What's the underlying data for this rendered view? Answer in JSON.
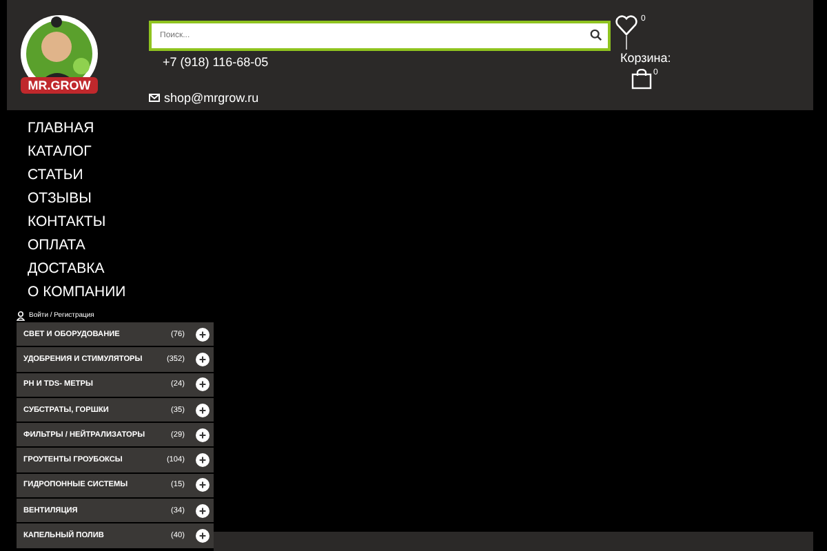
{
  "header": {
    "logo_text": "MR.GROW",
    "search": {
      "placeholder": "Поиск..."
    },
    "phone": "+7 (918) 116-68-05",
    "email": "shop@mrgrow.ru",
    "wishlist_count": "0",
    "cart_label": "Корзина:",
    "cart_count": "0"
  },
  "menu": [
    "ГЛАВНАЯ",
    "КАТАЛОГ",
    "СТАТЬИ",
    "ОТЗЫВЫ",
    "КОНТАКТЫ",
    "ОПЛАТА",
    "ДОСТАВКА",
    "О КОМПАНИИ"
  ],
  "login": "Войти / Регистрация",
  "categories": [
    {
      "name": "СВЕТ И ОБОРУДОВАНИЕ",
      "count": "(76)"
    },
    {
      "name": "УДОБРЕНИЯ И СТИМУЛЯТОРЫ",
      "count": "(352)"
    },
    {
      "name": "PH И TDS- МЕТРЫ",
      "count": "(24)"
    },
    {
      "name": "СУБСТРАТЫ, ГОРШКИ",
      "count": "(35)"
    },
    {
      "name": "ФИЛЬТРЫ / НЕЙТРАЛИЗАТОРЫ",
      "count": "(29)"
    },
    {
      "name": "ГРОУТЕНТЫ ГРОУБОКСЫ",
      "count": "(104)"
    },
    {
      "name": "ГИДРОПОННЫЕ СИСТЕМЫ",
      "count": "(15)"
    },
    {
      "name": "ВЕНТИЛЯЦИЯ",
      "count": "(34)"
    },
    {
      "name": "КАПЕЛЬНЫЙ ПОЛИВ",
      "count": "(40)"
    }
  ]
}
